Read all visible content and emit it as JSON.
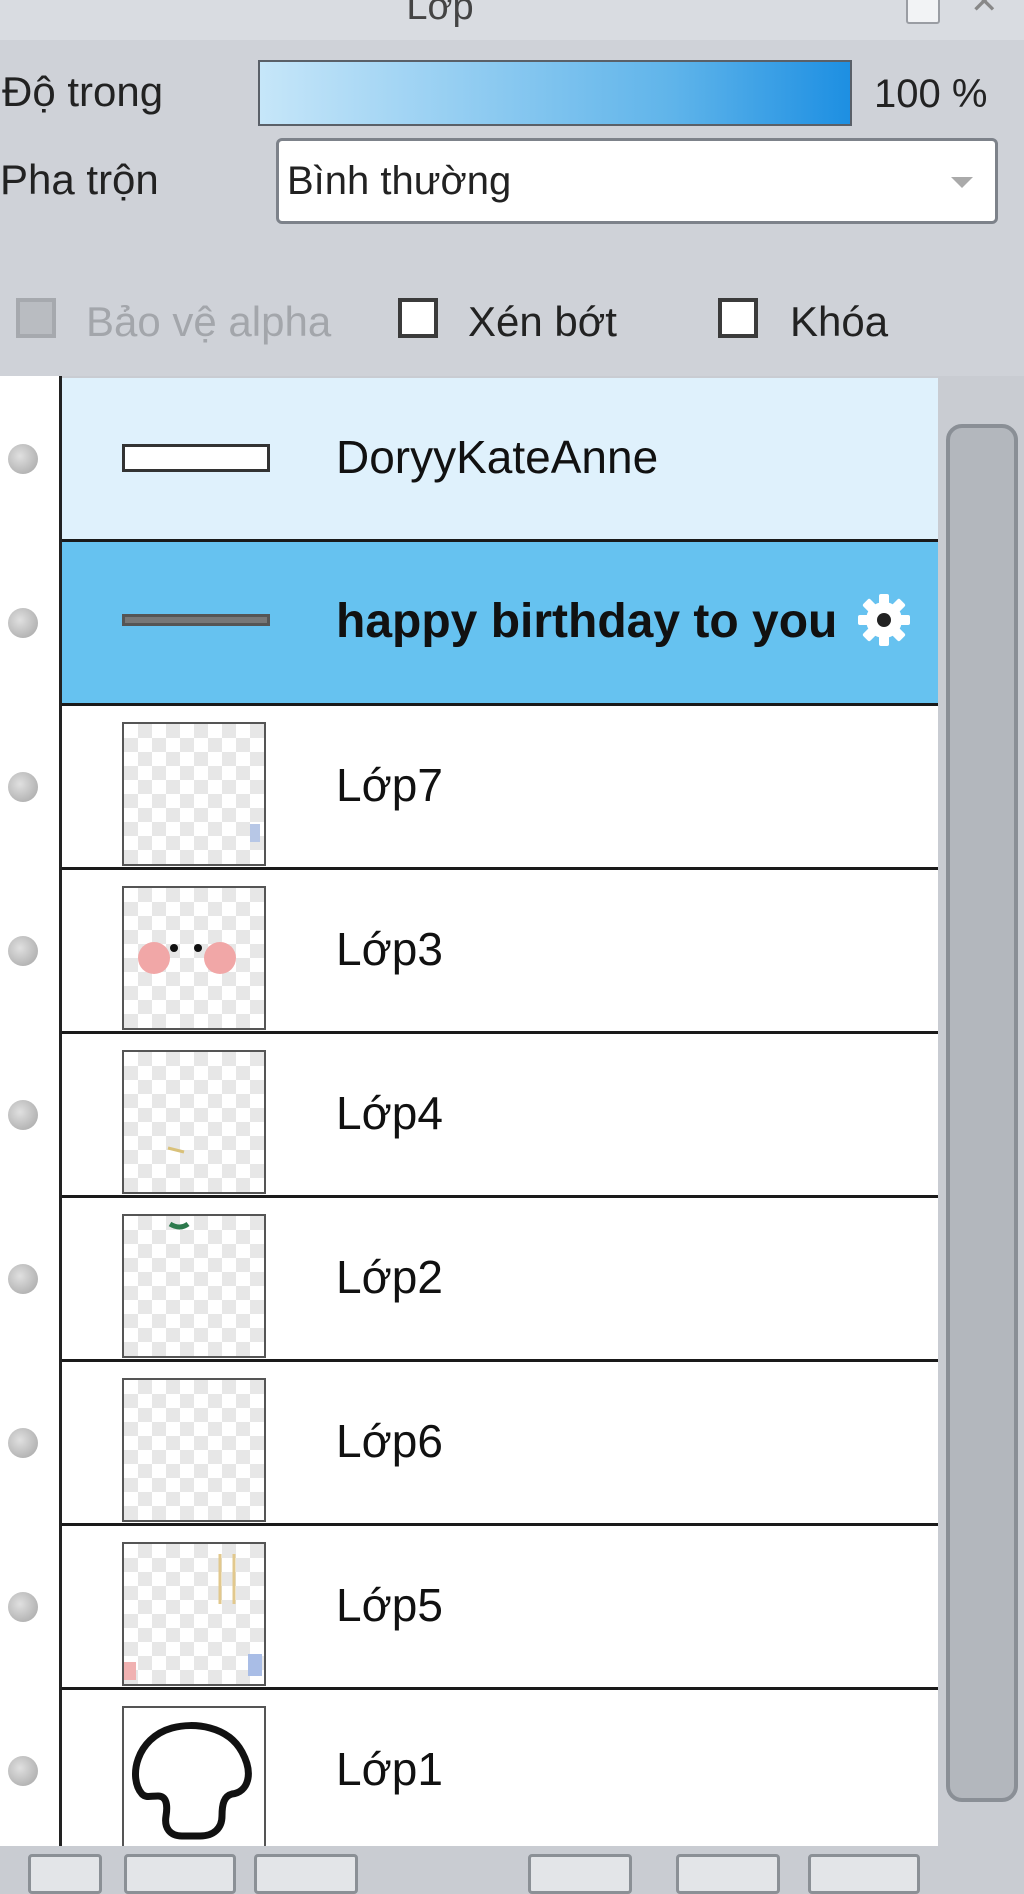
{
  "panel": {
    "title": "Lớp"
  },
  "opacity": {
    "label": "Độ trong",
    "value": "100 %",
    "level": 1.0
  },
  "blend": {
    "label": "Pha trộn",
    "value": "Bình thường"
  },
  "options": [
    {
      "label": "Bảo vệ alpha",
      "checked": false,
      "disabled": true
    },
    {
      "label": "Xén bớt",
      "checked": false,
      "disabled": false
    },
    {
      "label": "Khóa",
      "checked": false,
      "disabled": false
    }
  ],
  "layers": [
    {
      "name": "DoryyKateAnne",
      "kind": "text",
      "state": "selected"
    },
    {
      "name": "happy birthday to you",
      "kind": "text",
      "state": "active"
    },
    {
      "name": "Lớp7",
      "kind": "raster"
    },
    {
      "name": "Lớp3",
      "kind": "raster"
    },
    {
      "name": "Lớp4",
      "kind": "raster"
    },
    {
      "name": "Lớp2",
      "kind": "raster"
    },
    {
      "name": "Lớp6",
      "kind": "raster"
    },
    {
      "name": "Lớp5",
      "kind": "raster"
    },
    {
      "name": "Lớp1",
      "kind": "raster"
    }
  ],
  "colors": {
    "active_row": "#66c2f0",
    "selected_row": "#dff1fc",
    "opacity_fill": "#1d8fe2"
  }
}
